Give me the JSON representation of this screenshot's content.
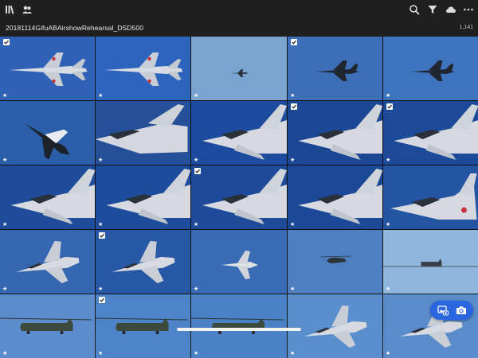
{
  "toolbar": {
    "left_icons": [
      "library-icon",
      "people-icon"
    ],
    "right_icons": [
      "search-icon",
      "filter-icon",
      "cloud-icon",
      "more-icon"
    ]
  },
  "album": {
    "title": "20181114GifuABAirshowRehearsal_DSD500",
    "count": "1,141"
  },
  "thumbnails": [
    {
      "bg": "#2f62b6",
      "subject": "fighter-top",
      "checked": true
    },
    {
      "bg": "#2d64bd",
      "subject": "fighter-top",
      "checked": false
    },
    {
      "bg": "#7aa3cf",
      "subject": "jet-far",
      "checked": false
    },
    {
      "bg": "#3d6fb8",
      "subject": "jet-far-dark",
      "checked": true
    },
    {
      "bg": "#3e73bd",
      "subject": "jet-far-dark",
      "checked": false
    },
    {
      "bg": "#2b5ea8",
      "subject": "jet-bank",
      "checked": false
    },
    {
      "bg": "#254f99",
      "subject": "jet-close-left",
      "checked": false
    },
    {
      "bg": "#1d4c9e",
      "subject": "jet-close",
      "checked": false
    },
    {
      "bg": "#1b4795",
      "subject": "jet-close",
      "checked": true
    },
    {
      "bg": "#1c4a98",
      "subject": "jet-close",
      "checked": true
    },
    {
      "bg": "#1e4c9b",
      "subject": "jet-close",
      "checked": false
    },
    {
      "bg": "#1e4c9c",
      "subject": "jet-close",
      "checked": false
    },
    {
      "bg": "#1d4a99",
      "subject": "jet-close",
      "checked": true
    },
    {
      "bg": "#1c4898",
      "subject": "jet-close",
      "checked": false
    },
    {
      "bg": "#2455a3",
      "subject": "jet-close-right",
      "checked": false
    },
    {
      "bg": "#3566b0",
      "subject": "jet-mid",
      "checked": false
    },
    {
      "bg": "#2758a5",
      "subject": "jet-mid",
      "checked": true
    },
    {
      "bg": "#3a6cb6",
      "subject": "jet-small",
      "checked": false
    },
    {
      "bg": "#4d7fc1",
      "subject": "heli-small",
      "checked": false
    },
    {
      "bg": "#8fb6dc",
      "subject": "chinook-small",
      "checked": false
    },
    {
      "bg": "#5b8ccb",
      "subject": "chinook",
      "checked": false
    },
    {
      "bg": "#4d83c7",
      "subject": "chinook",
      "checked": true
    },
    {
      "bg": "#4a80c4",
      "subject": "chinook",
      "checked": false
    },
    {
      "bg": "#5a8fcd",
      "subject": "jet-mid",
      "checked": false
    },
    {
      "bg": "#5a8ccb",
      "subject": "jet-mid",
      "checked": false
    }
  ],
  "fab": {
    "icons": [
      "add-to-album-icon",
      "camera-icon"
    ],
    "color": "#2a66e0"
  }
}
